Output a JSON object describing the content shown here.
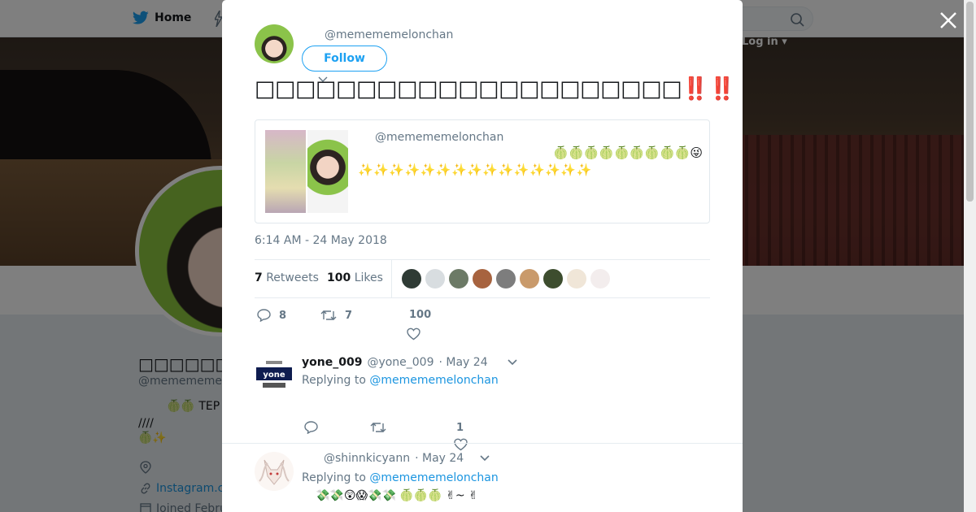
{
  "nav": {
    "home_label": "Home",
    "login_label": "Log in"
  },
  "profile": {
    "name": "",
    "handle": "@memememelonchan",
    "bio_line1": "🍈🍈 TEP",
    "bio_line2": "////",
    "bio_line3": "🍈✨",
    "link": "Instagram.c",
    "joined": "Joined Febru"
  },
  "tweet": {
    "author_handle": "@memememelonchan",
    "follow_label": "Follow",
    "text_part1": "□□□□□□□□□□□□□□□□□□□□□",
    "bangs1": "‼️‼️‼️",
    "text_part2": "□□□□□□□□□□□□□□□□□□",
    "bangs2": "‼️‼️‼️",
    "quote": {
      "handle": "@memememelonchan",
      "emoji_line": "🍈🍈🍈🍈🍈🍈🍈🍈🍈😜",
      "stars_line": "✨✨✨✨✨✨✨✨✨✨✨✨✨✨✨"
    },
    "timestamp": "6:14 AM - 24 May 2018",
    "retweets_count": "7",
    "retweets_label": "Retweets",
    "likes_count": "100",
    "likes_label": "Likes",
    "reply_count": "8",
    "retweet_count": "7",
    "like_count": "100"
  },
  "likers_colors": [
    "#2f3b35",
    "#d8dde0",
    "#6c7a66",
    "#a7633f",
    "#7d7d7d",
    "#c99a6b",
    "#3d4d2e",
    "#f0e6d8",
    "#f3eded"
  ],
  "replies": [
    {
      "name": "yone_009",
      "handle": "@yone_009",
      "date": "· May 24",
      "replying_label": "Replying to",
      "replying_to": "@memememelonchan",
      "body": "",
      "reply_count": "",
      "retweet_count": "",
      "like_count": "1"
    },
    {
      "name": "",
      "handle": "@shinnkicyann",
      "date": "· May 24",
      "replying_label": "Replying to",
      "replying_to": "@memememelonchan",
      "body": "💸💸😲😱💸💸 🍈🍈🍈 ✌~ ✌"
    }
  ],
  "colors": {
    "accent": "#1da1f2",
    "link": "#1b95e0",
    "bang": "#e0245e"
  }
}
